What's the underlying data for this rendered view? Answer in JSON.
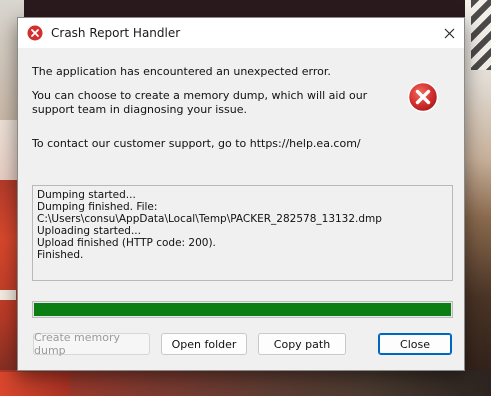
{
  "window": {
    "title": "Crash Report Handler",
    "close_glyph": "✕"
  },
  "messages": {
    "line1": "The application has encountered an unexpected error.",
    "line2": "You can choose to create a memory dump, which will aid our support team in diagnosing your issue.",
    "line3": "To contact our customer support, go to https://help.ea.com/"
  },
  "log": [
    "Dumping started...",
    "Dumping finished. File:",
    "C:\\Users\\consu\\AppData\\Local\\Temp\\PACKER_282578_13132.dmp",
    "Uploading started...",
    "Upload finished (HTTP code: 200).",
    "Finished."
  ],
  "progress": {
    "value": 1.0,
    "color": "#0a7d13"
  },
  "buttons": {
    "create_dump": "Create memory dump",
    "open_folder": "Open folder",
    "copy_path": "Copy path",
    "close": "Close"
  },
  "icons": {
    "title": "error-icon",
    "main": "error-icon",
    "close": "close-icon"
  },
  "colors": {
    "error_red": "#d32f2f",
    "accent": "#0067c0"
  }
}
